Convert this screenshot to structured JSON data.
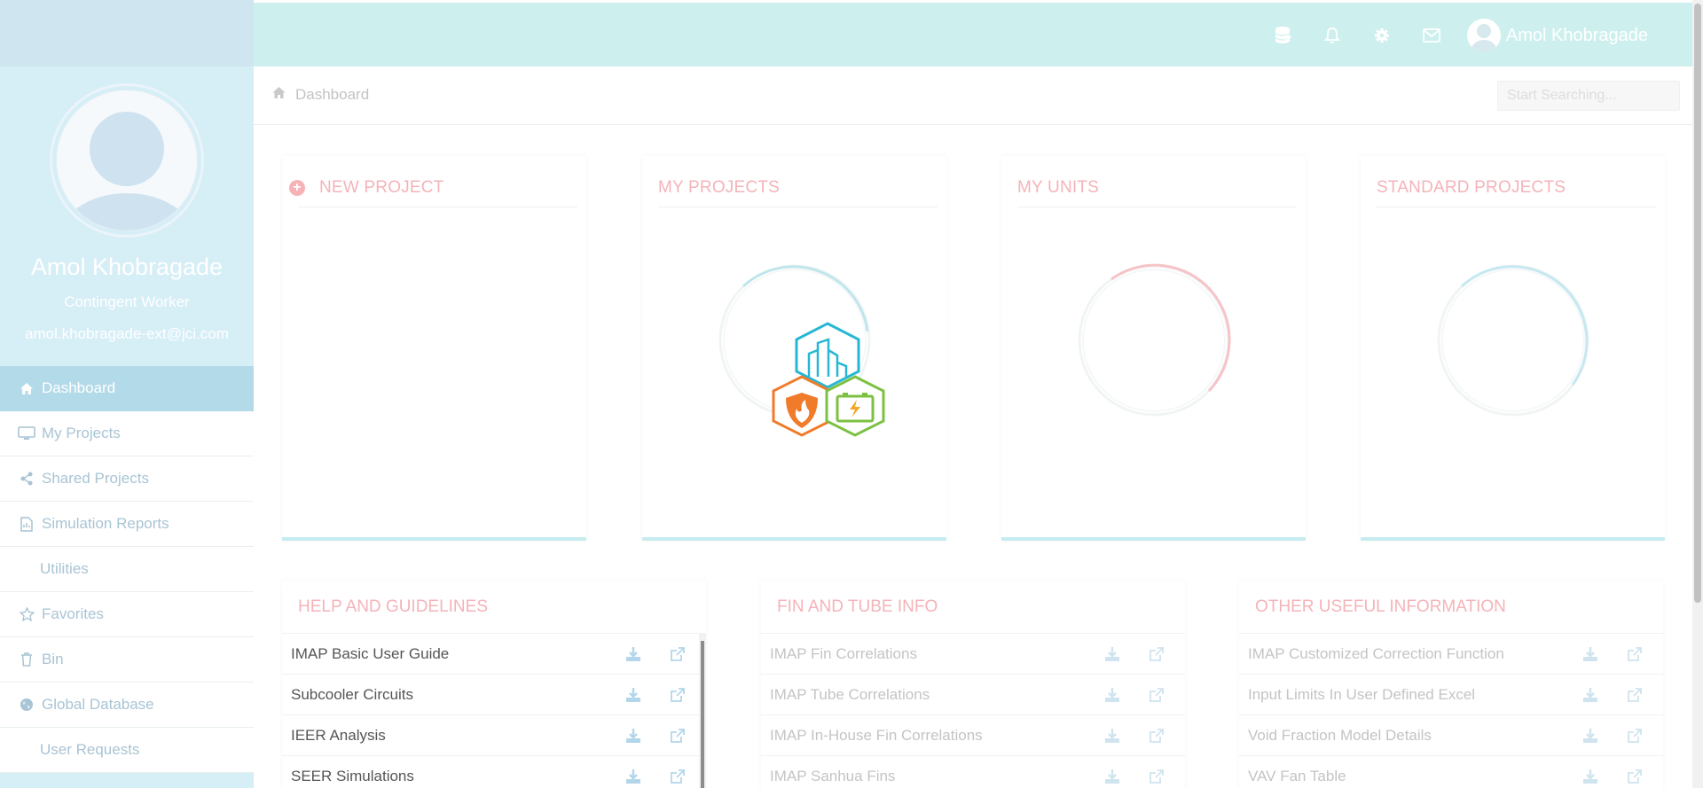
{
  "user": {
    "name": "Amol Khobragade",
    "role": "Contingent Worker",
    "email": "amol.khobragade-ext@jci.com"
  },
  "topbar": {
    "icons": [
      "database-icon",
      "bell-icon",
      "gear-icon",
      "envelope-icon"
    ],
    "user_name": "Amol Khobragade"
  },
  "sidebar": {
    "items": [
      {
        "label": "Dashboard",
        "icon": "home-icon",
        "active": true
      },
      {
        "label": "My Projects",
        "icon": "monitor-icon"
      },
      {
        "label": "Shared Projects",
        "icon": "share-icon"
      },
      {
        "label": "Simulation Reports",
        "icon": "report-icon"
      },
      {
        "label": "Utilities",
        "icon": ""
      },
      {
        "label": "Favorites",
        "icon": "star-icon"
      },
      {
        "label": "Bin",
        "icon": "trash-icon"
      },
      {
        "label": "Global Database",
        "icon": "globe-icon"
      },
      {
        "label": "User Requests",
        "icon": ""
      }
    ]
  },
  "breadcrumb": {
    "current": "Dashboard"
  },
  "search": {
    "placeholder": "Start Searching..."
  },
  "cards": {
    "new_project": "NEW PROJECT",
    "my_projects": "MY PROJECTS",
    "my_units": "MY UNITS",
    "standard_projects": "STANDARD PROJECTS"
  },
  "panels": {
    "help": {
      "title": "HELP AND GUIDELINES",
      "rows": [
        "IMAP Basic User Guide",
        "Subcooler Circuits",
        "IEER Analysis",
        "SEER Simulations"
      ]
    },
    "fin": {
      "title": "FIN AND TUBE INFO",
      "rows": [
        "IMAP Fin Correlations",
        "IMAP Tube Correlations",
        "IMAP In-House Fin Correlations",
        "IMAP Sanhua Fins"
      ]
    },
    "other": {
      "title": "OTHER USEFUL INFORMATION",
      "rows": [
        "IMAP Customized Correction Function",
        "Input Limits In User Defined Excel",
        "Void Fraction Model Details",
        "VAV Fan Table"
      ]
    }
  },
  "colors": {
    "accent_pink": "#f5b3b8",
    "topbar": "#cdf0ee",
    "sidebar": "#d6eef6",
    "active_nav": "#b3dae8"
  }
}
